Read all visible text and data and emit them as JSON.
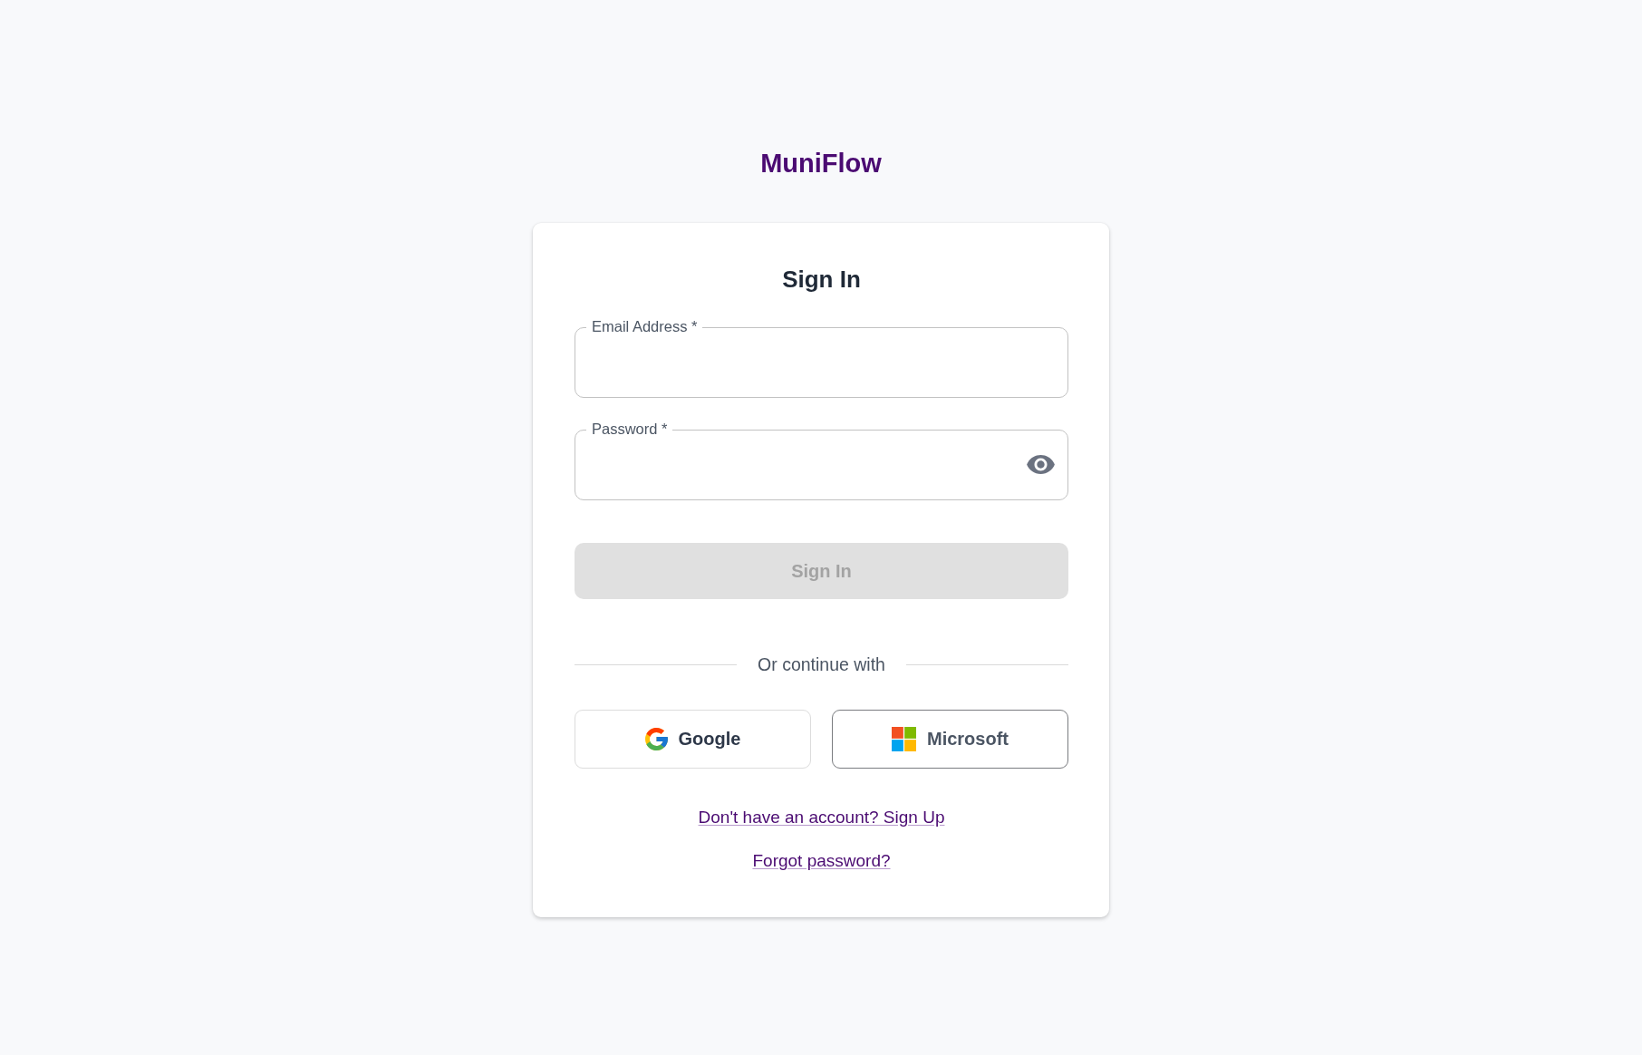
{
  "brand": {
    "name": "MuniFlow"
  },
  "card": {
    "title": "Sign In",
    "fields": [
      {
        "kind": "email",
        "label": "Email Address *"
      },
      {
        "kind": "password",
        "label": "Password *"
      }
    ],
    "submit_button": {
      "label": "Sign In",
      "disabled": true
    },
    "divider_text": "Or continue with",
    "social_buttons": [
      {
        "kind": "google",
        "label": "Google"
      },
      {
        "kind": "microsoft",
        "label": "Microsoft"
      }
    ],
    "links": [
      "Don't have an account? Sign Up",
      "Forgot password?"
    ]
  }
}
